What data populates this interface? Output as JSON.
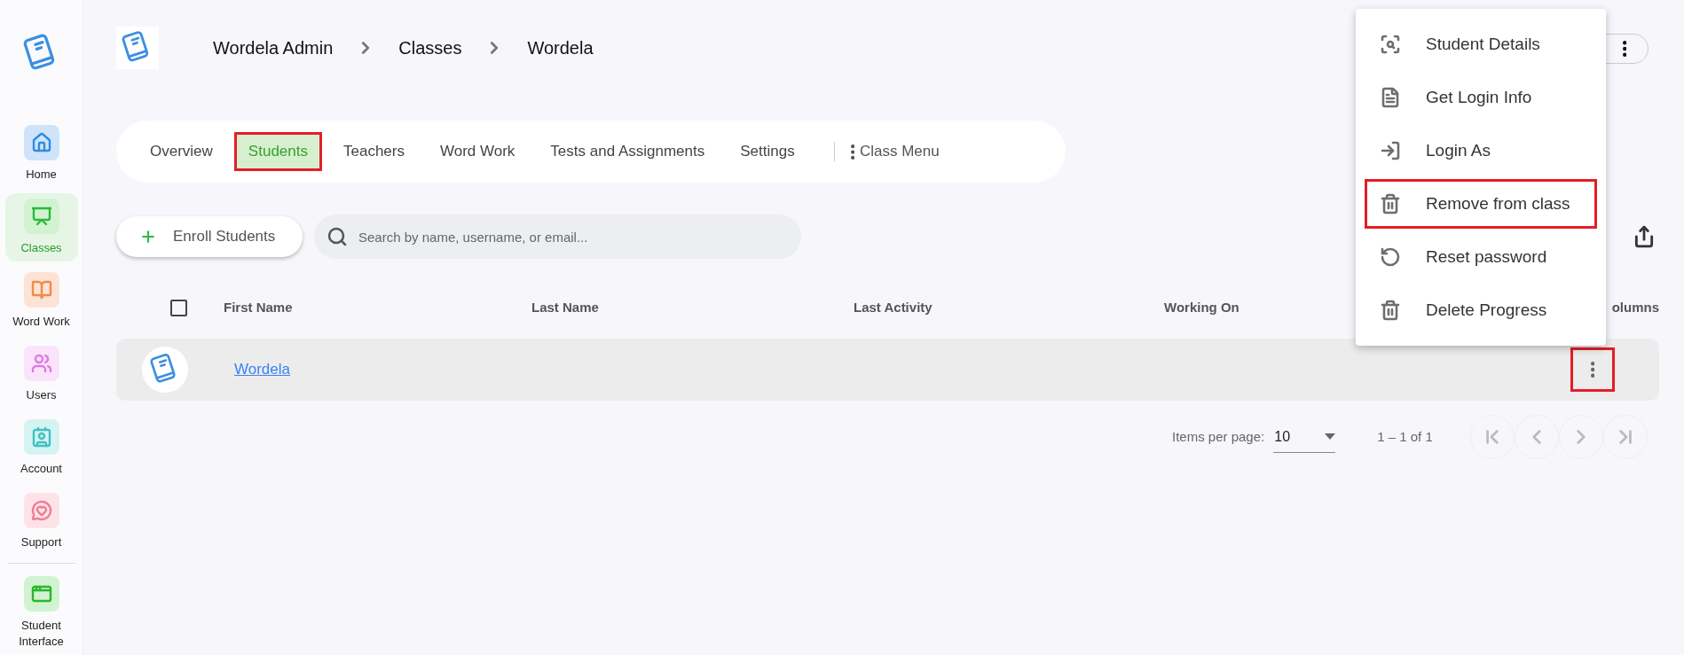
{
  "sidebar": {
    "items": [
      {
        "label": "Home",
        "kind": "home",
        "selected": false
      },
      {
        "label": "Classes",
        "kind": "classes",
        "selected": true
      },
      {
        "label": "Word Work",
        "kind": "book",
        "selected": false
      },
      {
        "label": "Users",
        "kind": "users",
        "selected": false
      },
      {
        "label": "Account",
        "kind": "account",
        "selected": false
      },
      {
        "label": "Support",
        "kind": "support",
        "selected": false
      },
      {
        "label": "Student Interface",
        "kind": "student",
        "selected": false
      }
    ]
  },
  "breadcrumb": [
    "Wordela Admin",
    "Classes",
    "Wordela"
  ],
  "tabs": [
    {
      "label": "Overview",
      "selected": false,
      "highlighted": false
    },
    {
      "label": "Students",
      "selected": true,
      "highlighted": true
    },
    {
      "label": "Teachers",
      "selected": false,
      "highlighted": false
    },
    {
      "label": "Word Work",
      "selected": false,
      "highlighted": false
    },
    {
      "label": "Tests and Assignments",
      "selected": false,
      "highlighted": false
    },
    {
      "label": "Settings",
      "selected": false,
      "highlighted": false
    }
  ],
  "class_menu": "Class Menu",
  "toolbar": {
    "enroll_button": "Enroll Students",
    "search": {
      "placeholder": "Search by name, username, or email..."
    }
  },
  "table": {
    "header_checkbox": {
      "checked": false
    },
    "columns": [
      "First Name",
      "Last Name",
      "Last Activity",
      "Working On",
      "olumns"
    ],
    "rows": [
      {
        "first_name": "Wordela",
        "menu_highlighted": true
      }
    ]
  },
  "pagination": {
    "label": "Items per page:",
    "page_size": "10",
    "range": "1 – 1 of 1"
  },
  "row_menu": {
    "items": [
      {
        "label": "Student Details",
        "kind": "details",
        "highlighted": false
      },
      {
        "label": "Get Login Info",
        "kind": "document",
        "highlighted": false
      },
      {
        "label": "Login As",
        "kind": "login",
        "highlighted": false
      },
      {
        "label": "Remove from class",
        "kind": "trash",
        "highlighted": true
      },
      {
        "label": "Reset password",
        "kind": "reset",
        "highlighted": false
      },
      {
        "label": "Delete Progress",
        "kind": "trash",
        "highlighted": false
      }
    ]
  }
}
